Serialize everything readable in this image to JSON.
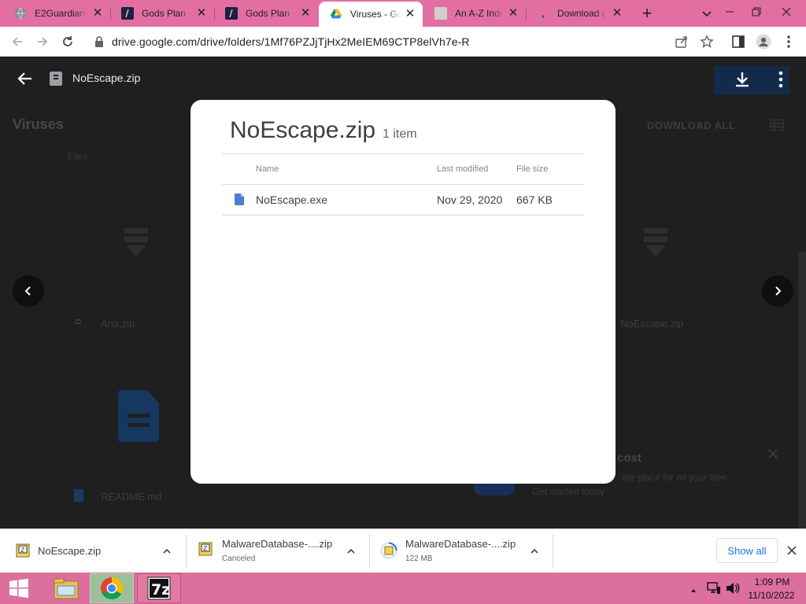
{
  "tabs": [
    {
      "title": "E2Guardian",
      "icon": "globe-icon",
      "active": false
    },
    {
      "title": "Gods Plan - ",
      "icon": "gods-plan-favicon",
      "active": false
    },
    {
      "title": "Gods Plan - ",
      "icon": "gods-plan-favicon",
      "active": false
    },
    {
      "title": "Viruses - Go",
      "icon": "google-drive-icon",
      "active": true
    },
    {
      "title": "An A-Z Inde",
      "icon": "blank-page-icon",
      "active": false
    },
    {
      "title": "Download (",
      "icon": "loading-dot-icon",
      "active": false
    }
  ],
  "address_bar": {
    "url": "drive.google.com/drive/folders/1Mf76PZJjTjHx2MeIEM69CTP8elVh7e-R"
  },
  "viewer": {
    "filename": "NoEscape.zip"
  },
  "background": {
    "folder_title": "Viruses",
    "files_label": "Files",
    "download_all": "DOWNLOAD ALL",
    "files": [
      "Ana.zip",
      "NoEscape.zip",
      "README.md"
    ],
    "promo_title": "cost",
    "promo_text": "afe place for all your files",
    "promo_link": "Get started today"
  },
  "dialog": {
    "title": "NoEscape.zip",
    "item_count": "1 item",
    "columns": {
      "name": "Name",
      "modified": "Last modified",
      "size": "File size"
    },
    "rows": [
      {
        "name": "NoEscape.exe",
        "modified": "Nov 29, 2020",
        "size": "667 KB"
      }
    ]
  },
  "downloads": {
    "items": [
      {
        "name": "NoEscape.zip",
        "status": ""
      },
      {
        "name": "MalwareDatabase-....zip",
        "status": "Canceled"
      },
      {
        "name": "MalwareDatabase-....zip",
        "status": "122 MB"
      }
    ],
    "show_all": "Show all"
  },
  "taskbar": {
    "time": "1:09 PM",
    "date": "11/10/2022"
  },
  "colors": {
    "tab_strip": "#e36fa2",
    "taskbar": "#dc6f9e",
    "link_blue": "#1a73e8"
  }
}
